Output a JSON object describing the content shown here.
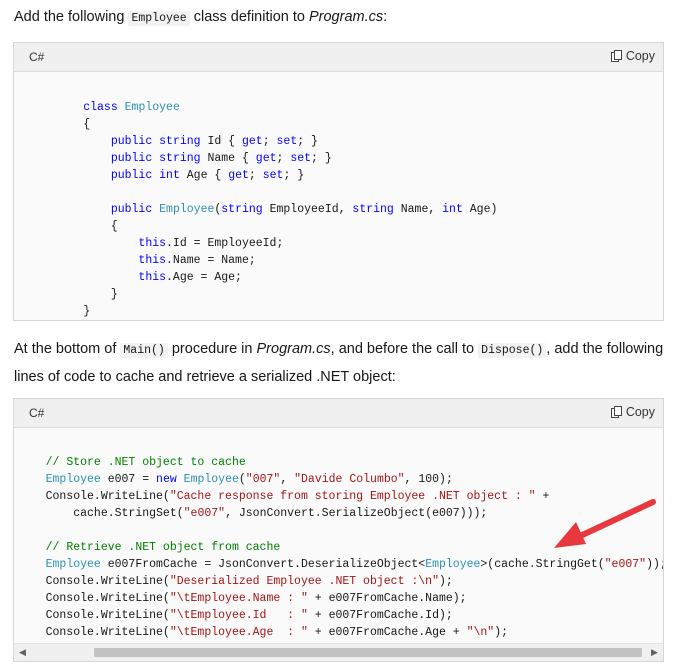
{
  "intro": {
    "prefix": "Add the following",
    "code": "Employee",
    "middle": "class definition to",
    "file": "Program.cs",
    "suffix": ":"
  },
  "block1": {
    "language": "C#",
    "copy_label": "Copy",
    "lines": [
      "",
      "        class Employee",
      "        {",
      "            public string Id { get; set; }",
      "            public string Name { get; set; }",
      "            public int Age { get; set; }",
      "",
      "            public Employee(string EmployeeId, string Name, int Age)",
      "            {",
      "                this.Id = EmployeeId;",
      "                this.Name = Name;",
      "                this.Age = Age;",
      "            }",
      "        }"
    ]
  },
  "middle_text": {
    "part1": "At the bottom of",
    "code1": "Main()",
    "part2": "procedure in",
    "file": "Program.cs",
    "part3": ", and before the call to",
    "code2": "Dispose()",
    "part4": ", add the following",
    "line2": "lines of code to cache and retrieve a serialized .NET object:"
  },
  "block2": {
    "language": "C#",
    "copy_label": "Copy",
    "lines": [
      "",
      "    // Store .NET object to cache",
      "    Employee e007 = new Employee(\"007\", \"Davide Columbo\", 100);",
      "    Console.WriteLine(\"Cache response from storing Employee .NET object : \" +",
      "        cache.StringSet(\"e007\", JsonConvert.SerializeObject(e007)));",
      "",
      "    // Retrieve .NET object from cache",
      "    Employee e007FromCache = JsonConvert.DeserializeObject<Employee>(cache.StringGet(\"e007\"));",
      "    Console.WriteLine(\"Deserialized Employee .NET object :\\n\");",
      "    Console.WriteLine(\"\\tEmployee.Name : \" + e007FromCache.Name);",
      "    Console.WriteLine(\"\\tEmployee.Id   : \" + e007FromCache.Id);",
      "    Console.WriteLine(\"\\tEmployee.Age  : \" + e007FromCache.Age + \"\\n\");"
    ]
  },
  "colors": {
    "keyword": "#0000ff",
    "type": "#2b91af",
    "string": "#a31515",
    "comment": "#008000",
    "arrow": "#e8383d"
  },
  "icons": {
    "copy": "copy-icon",
    "arrow": "annotation-arrow",
    "scroll_left": "scroll-left-icon",
    "scroll_right": "scroll-right-icon"
  }
}
